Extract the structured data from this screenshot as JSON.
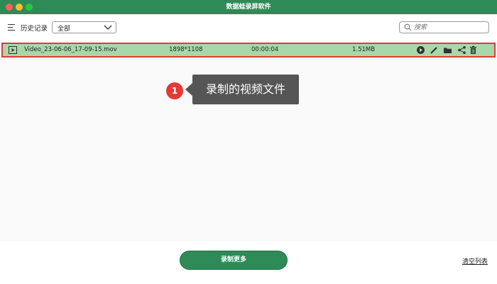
{
  "window": {
    "title": "数据蛙录屏软件"
  },
  "toolbar": {
    "history_label": "历史记录",
    "filter": {
      "selected": "全部"
    },
    "search": {
      "placeholder": "搜索"
    }
  },
  "recordings": [
    {
      "name": "Video_23-06-06_17-09-15.mov",
      "resolution": "1898*1108",
      "duration": "00:00:04",
      "size": "1.51MB"
    }
  ],
  "row_actions": [
    "play-icon",
    "edit-icon",
    "folder-icon",
    "share-icon",
    "trash-icon"
  ],
  "annotation": {
    "number": "1",
    "text": "录制的视频文件"
  },
  "footer": {
    "record_more": "录制更多",
    "clear_list": "清空列表"
  },
  "colors": {
    "brand": "#2e8b57",
    "row_highlight": "#a8d8a8",
    "annotation_red": "#e53935"
  }
}
